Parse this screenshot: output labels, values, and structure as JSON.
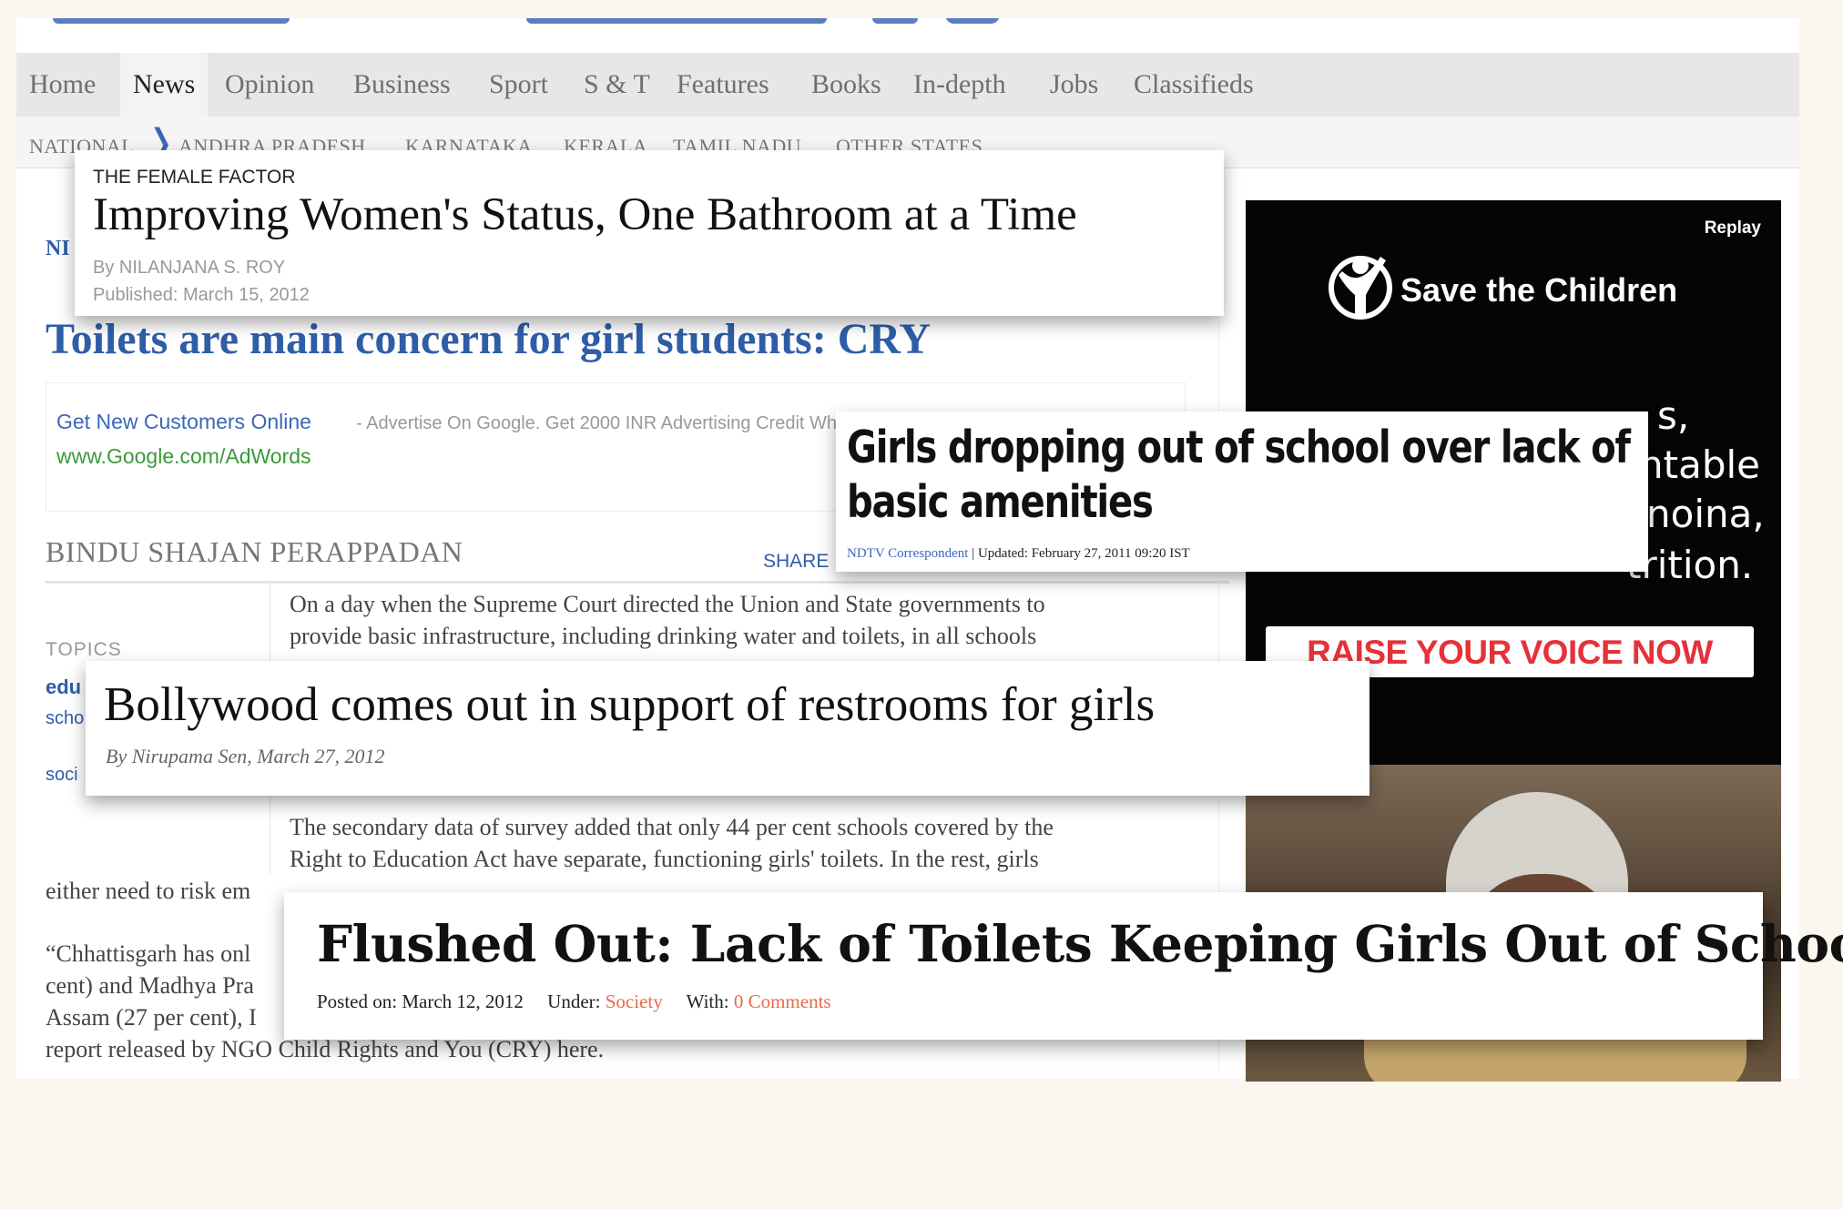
{
  "nav": {
    "items": [
      "Home",
      "News",
      "Opinion",
      "Business",
      "Sport",
      "S & T",
      "Features",
      "Books",
      "In-depth",
      "Jobs",
      "Classifieds"
    ]
  },
  "subnav": {
    "items": [
      "NATIONAL",
      "ANDHRA PRADESH",
      "KARNATAKA",
      "KERALA",
      "TAMIL NADU",
      "OTHER STATES"
    ]
  },
  "article": {
    "section": "NI",
    "headline": "Toilets are main concern for girl students: CRY",
    "ad_link": "Get New Customers Online",
    "ad_text": "- Advertise On Google. Get 2000 INR Advertising Credit When You Sign-Up",
    "ad_url": "www.Google.com/AdWords",
    "byline": "BINDU SHAJAN PERAPPADAN",
    "share": "SHARE",
    "topics_label": "TOPICS",
    "tags": [
      "edu",
      "scho",
      "soci"
    ],
    "para1": [
      "On a day when the Supreme Court directed the Union and State governments to",
      "provide basic infrastructure, including drinking water and toilets, in all schools"
    ],
    "para2": [
      "The secondary data of survey added that only 44 per cent schools covered by the",
      "Right to Education Act have separate, functioning girls' toilets. In the rest, girls",
      "either need to risk em"
    ],
    "para3": [
      "“Chhattisgarh has onl",
      "cent) and Madhya Pra",
      "Assam (27 per cent), I",
      "report released by NGO Child Rights and You (CRY) here."
    ]
  },
  "ad": {
    "replay": "Replay",
    "brand": "Save the Children",
    "copy_lines": [
      "s,",
      "ntable",
      "noina,",
      "trition."
    ],
    "cta": "RAISE YOUR VOICE NOW"
  },
  "cards": {
    "c1": {
      "kicker": "THE FEMALE FACTOR",
      "title": "Improving Women's Status, One Bathroom at a Time",
      "by": "By NILANJANA S. ROY",
      "published": "Published: March 15, 2012"
    },
    "c2": {
      "title": "Girls dropping out of school over lack of basic amenities",
      "correspondent": "NDTV Correspondent",
      "updated": " | Updated: February 27, 2011 09:20 IST"
    },
    "c3": {
      "title": "Bollywood comes out in support of  restrooms for girls",
      "by": "By Nirupama Sen, March 27, 2012"
    },
    "c4": {
      "title": "Flushed Out: Lack of Toilets Keeping Girls Out of School",
      "posted": "Posted on: March 12, 2012",
      "under_label": "Under:",
      "under_value": "Society",
      "with_label": "With:",
      "with_value": "0 Comments"
    }
  },
  "colors": {
    "link_blue": "#2f5ea8",
    "cta_red": "#e6313b",
    "ad_green": "#3a9a3a",
    "comment_orange": "#e86a4a"
  }
}
